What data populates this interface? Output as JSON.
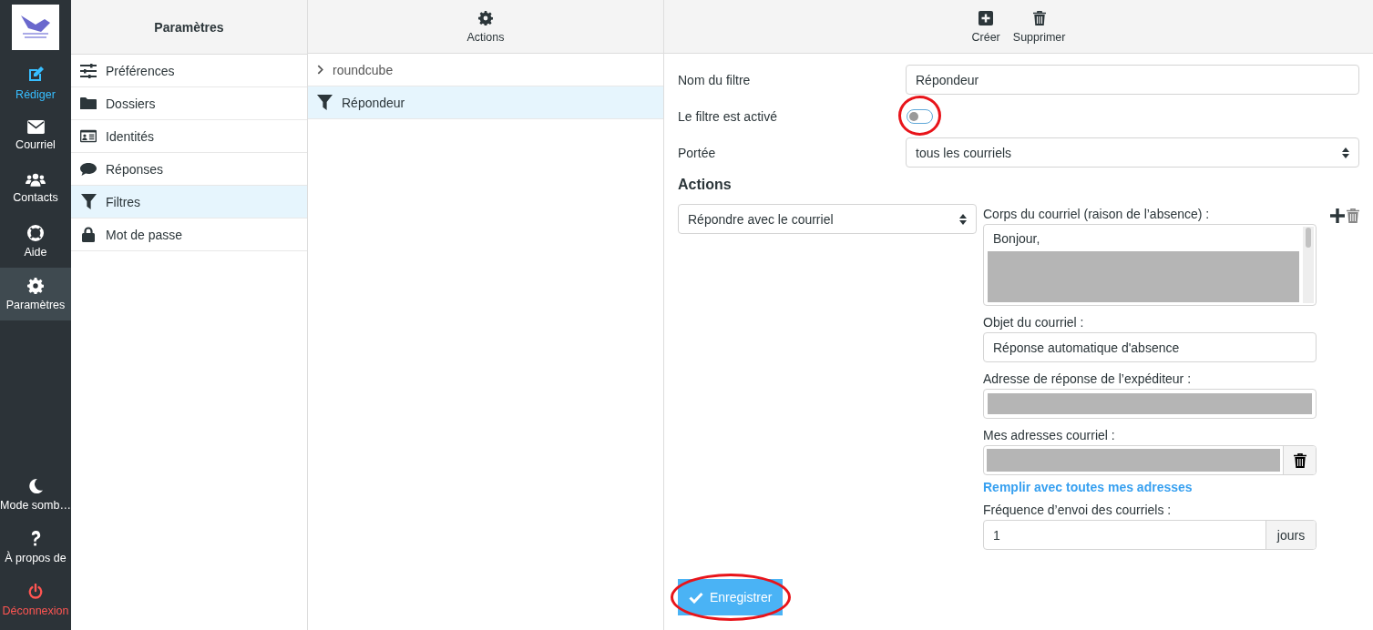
{
  "nav": {
    "items": [
      {
        "label": "Rédiger",
        "kind": "compose",
        "selected": false
      },
      {
        "label": "Courriel",
        "kind": "mail",
        "selected": false
      },
      {
        "label": "Contacts",
        "kind": "contacts",
        "selected": false
      },
      {
        "label": "Aide",
        "kind": "help",
        "selected": false
      },
      {
        "label": "Paramètres",
        "kind": "settings",
        "selected": true
      }
    ],
    "bottom_items": [
      {
        "label": "Mode somb…",
        "kind": "theme"
      },
      {
        "label": "À propos de",
        "kind": "about"
      },
      {
        "label": "Déconnexion",
        "kind": "logout"
      }
    ]
  },
  "settings_panel": {
    "title": "Paramètres",
    "items": [
      {
        "label": "Préférences",
        "kind": "sliders",
        "selected": false
      },
      {
        "label": "Dossiers",
        "kind": "folder",
        "selected": false
      },
      {
        "label": "Identités",
        "kind": "idcard",
        "selected": false
      },
      {
        "label": "Réponses",
        "kind": "comment",
        "selected": false
      },
      {
        "label": "Filtres",
        "kind": "filter",
        "selected": true
      },
      {
        "label": "Mot de passe",
        "kind": "lock",
        "selected": false
      }
    ]
  },
  "filters_panel": {
    "toolbar": [
      {
        "label": "Actions",
        "kind": "gear"
      }
    ],
    "items": [
      {
        "label": "roundcube",
        "kind": "set",
        "selected": false
      },
      {
        "label": "Répondeur",
        "kind": "filter",
        "selected": true
      }
    ]
  },
  "form": {
    "toolbar": [
      {
        "label": "Créer",
        "kind": "create"
      },
      {
        "label": "Supprimer",
        "kind": "delete"
      }
    ],
    "name_label": "Nom du filtre",
    "name_value": "Répondeur",
    "enabled_label": "Le filtre est activé",
    "enabled": {
      "on": false,
      "highlighted": true
    },
    "scope_label": "Portée",
    "scope_value": "tous les courriels",
    "actions_heading": "Actions",
    "action_select": "Répondre avec le courriel",
    "body_label": "Corps du courriel (raison de l’absence) :",
    "body_value": "Bonjour,",
    "subject_label": "Objet du courriel :",
    "subject_value": "Réponse automatique d'absence",
    "sender_label": "Adresse de réponse de l’expéditeur :",
    "addresses_label": "Mes adresses courriel :",
    "fill_link": "Remplir avec toutes mes adresses",
    "frequency_label": "Fréquence d’envoi des courriels :",
    "frequency_value": "1",
    "frequency_unit": "jours",
    "save": {
      "label": "Enregistrer",
      "highlighted": true
    }
  }
}
